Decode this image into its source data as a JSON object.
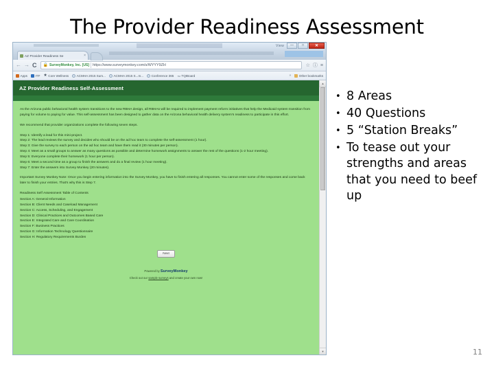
{
  "slide": {
    "title": "The Provider Readiness Assessment",
    "page_number": "11"
  },
  "browser": {
    "window_title_ghost": "",
    "window_controls": {
      "restore_label": "View",
      "minimize": "—",
      "maximize": "□",
      "close": "✕"
    },
    "tab": {
      "title": "AZ Provider Readiness Se",
      "close_glyph": "×",
      "favicon": "page-favicon"
    },
    "toolbar": {
      "back_glyph": "←",
      "forward_glyph": "→",
      "reload_glyph": "C",
      "lock_glyph": "🔒",
      "secure_label": "SurveyMonkey, Inc. [US]",
      "url": "https://www.surveymonkey.com/s/WYYY9ZH",
      "star_glyph": "☆",
      "info_glyph": "ⓘ",
      "menu_glyph": "≡"
    },
    "bookmarks": [
      {
        "label": "Apps",
        "icon": "apps-grid-icon"
      },
      {
        "label": "ITF",
        "icon": "blue-square-icon"
      },
      {
        "label": "Core Wellness",
        "icon": "star-icon"
      },
      {
        "label": "ACMHA 2015 Sum...",
        "icon": "globe-icon"
      },
      {
        "label": "ACMHA 2015 S...m...",
        "icon": "globe-icon"
      },
      {
        "label": "Conference 365",
        "icon": "globe-icon"
      },
      {
        "label": "TQIBoard",
        "icon": "text-icon"
      }
    ],
    "bookmarks_overflow_glyph": "»",
    "other_bookmarks": {
      "label": "Other bookmarks",
      "icon": "folder-icon"
    }
  },
  "survey": {
    "header": "AZ Provider Readiness Self-Assessment",
    "intro": "As the Arizona public behavioral health system transitions to the new RBHA design, all RBHAs will be required to implement payment reform initiatives that help the Medicaid system transition from paying for volume to paying for value. This self-assessment has been designed to gather data on the Arizona behavioral health delivery system's readiness to participate in this effort.",
    "recommend": "We recommend that provider organizations complete the following seven steps.",
    "steps": [
      "Step 1: Identify a lead for this mini-project.",
      "Step 2: The lead reviews the survey and decides who should be on the ad hoc team to complete the self-assessment (1 hour).",
      "Step 3: Give the survey to each person on the ad hoc team and have them read it (30 minutes per person).",
      "Step 4: Meet as a small groups to answer as many questions as possible and determine homework assignments to answer the rest of the questions (1-2 hour meeting).",
      "Step 5: Everyone complete their homework (1 hour per person).",
      "Step 6: Meet a second time as a group to finish the answers and do a final review (1 hour meeting).",
      "Step 7: Enter the answers into Survey Monkey (20 minutes)."
    ],
    "note": "Important Survey Monkey Note: Once you begin entering information into the Survey Monkey, you have to finish entering all responses. You cannot enter some of the responses and come back later to finish your entries. That's why this is Step 7.",
    "toc_title": "Readiness Self Assessment Table of Contents",
    "toc": [
      "Section A: General Information",
      "Section B: Client Needs and Caseload Management",
      "Section C: Access, Scheduling, and Engagement",
      "Section D: Clinical Practices and Outcomes Based Care",
      "Section E: Integrated Care and Care Coordination",
      "Section F: Business Practices",
      "Section G: Information Technology Questionnaire",
      "Section H: Regulatory Requirements Burden"
    ],
    "next_button": "Next",
    "footer_powered": "Powered by",
    "footer_brand": "SurveyMonkey",
    "footer_line2_a": "Check out our ",
    "footer_line2_link": "sample surveys",
    "footer_line2_b": " and create your own now!"
  },
  "bullets": [
    "8 Areas",
    "40 Questions",
    "5 “Station Breaks”",
    "To tease out your strengths and areas that you need to beef up"
  ],
  "bullet_glyph": "•",
  "colors": {
    "survey_header_green": "#25662f",
    "survey_subbar_green": "#2e7a3a",
    "page_green": "#9fe08c",
    "close_red": "#bb2414",
    "secure_green": "#2f8b3e"
  }
}
